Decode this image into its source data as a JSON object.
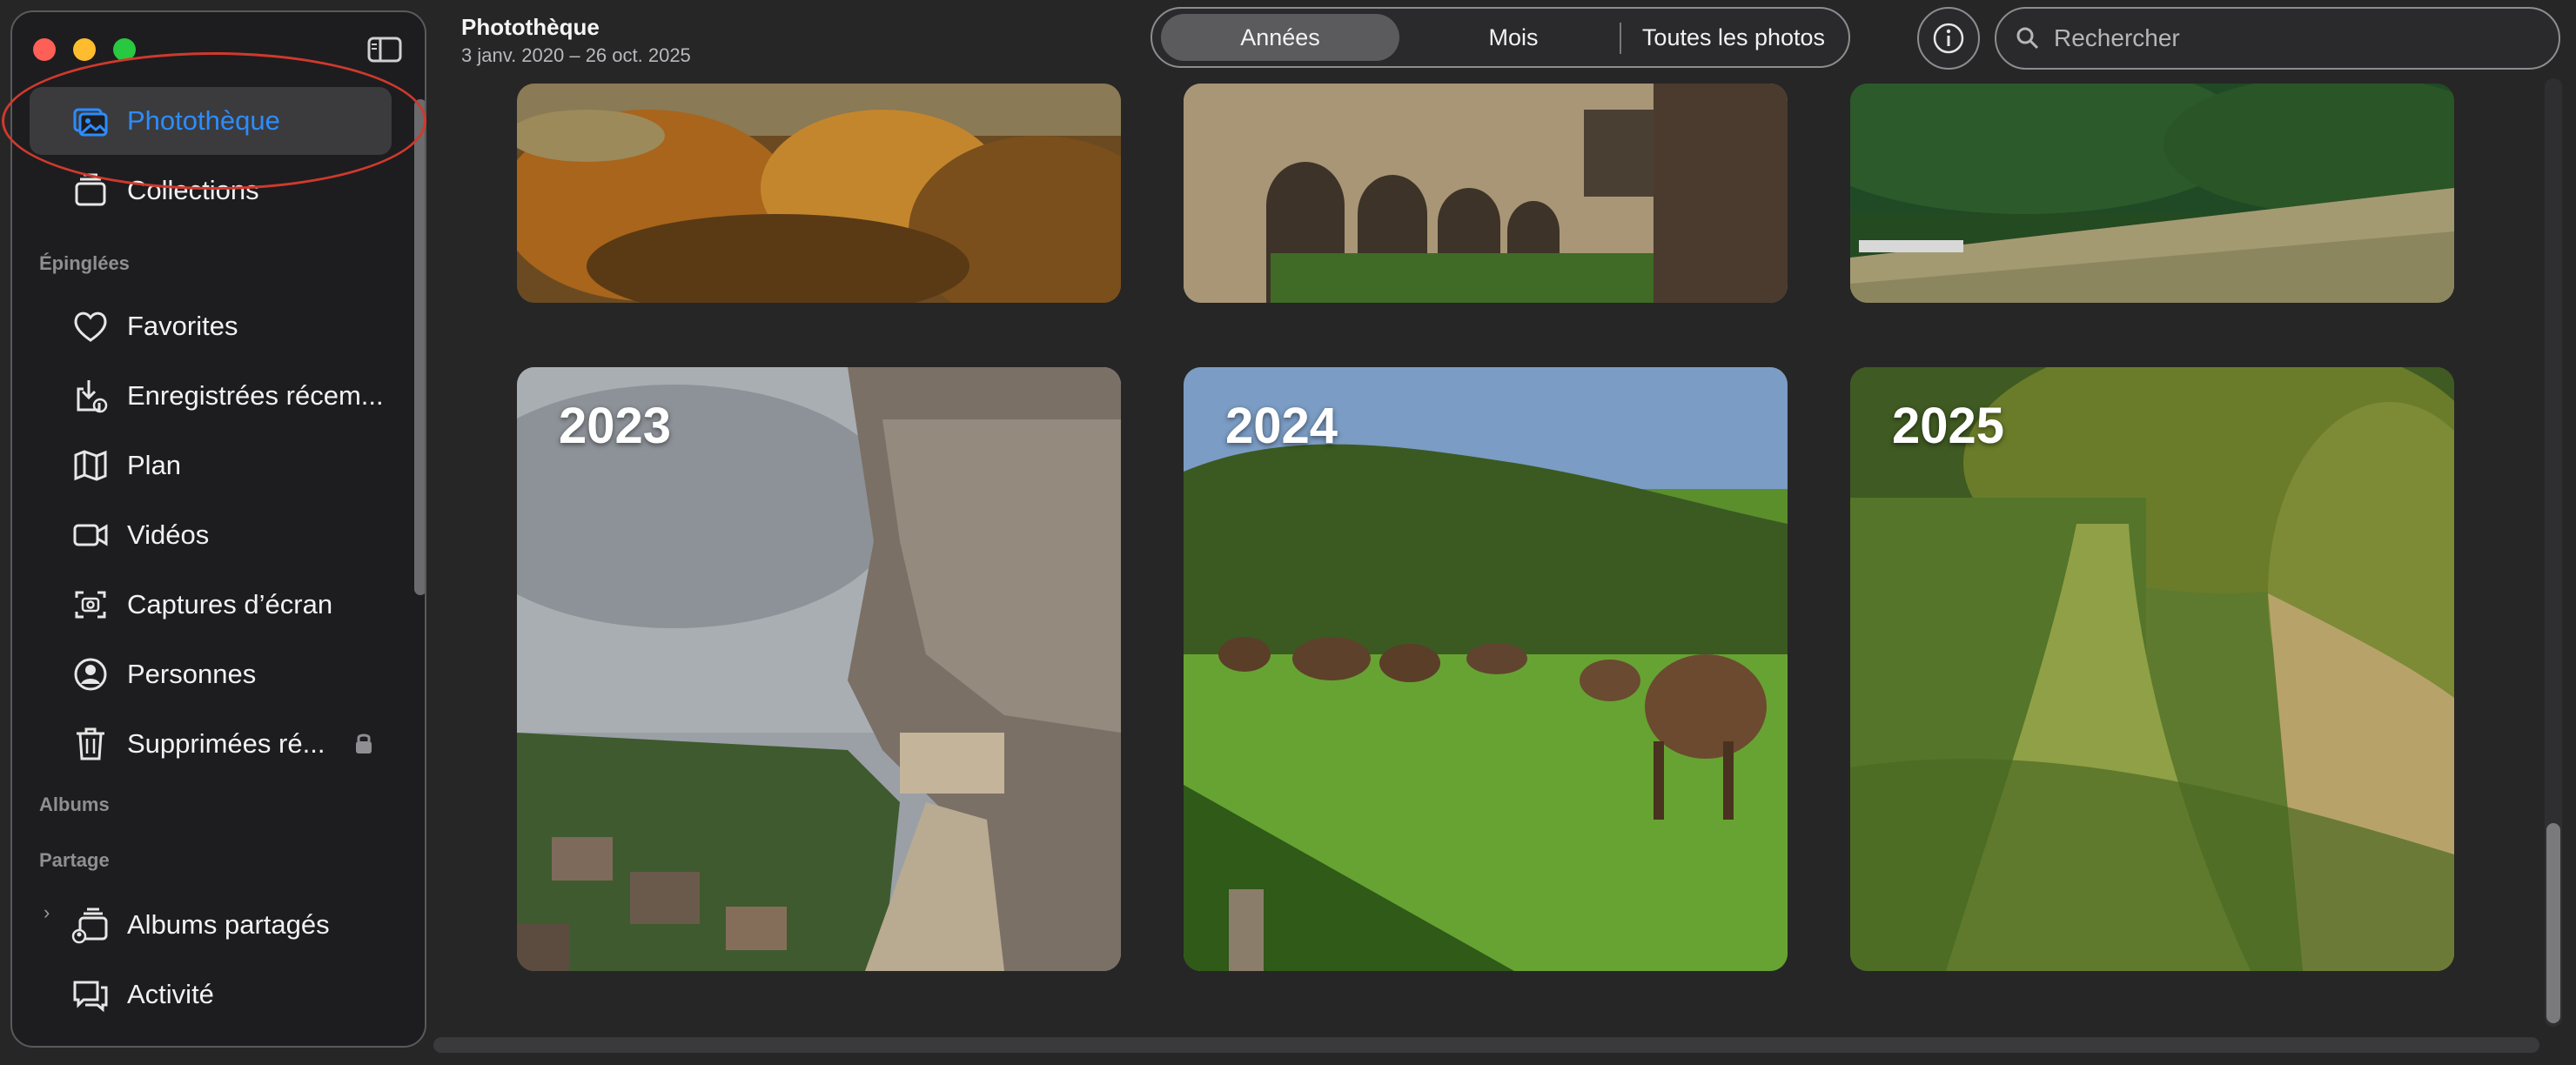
{
  "header": {
    "title": "Photothèque",
    "date_range": "3 janv. 2020 – 26 oct. 2025"
  },
  "view_tabs": [
    {
      "label": "Années",
      "active": true
    },
    {
      "label": "Mois",
      "active": false
    },
    {
      "label": "Toutes les photos",
      "active": false
    }
  ],
  "search": {
    "placeholder": "Rechercher",
    "value": ""
  },
  "sidebar": {
    "top_items": [
      {
        "label": "Photothèque",
        "icon": "photo-library-icon",
        "selected": true
      },
      {
        "label": "Collections",
        "icon": "collections-icon",
        "selected": false
      }
    ],
    "pinned_header": "Épinglées",
    "pinned_items": [
      {
        "label": "Favorites",
        "icon": "heart-icon"
      },
      {
        "label": "Enregistrées récem...",
        "icon": "recently-saved-icon"
      },
      {
        "label": "Plan",
        "icon": "map-icon"
      },
      {
        "label": "Vidéos",
        "icon": "video-icon"
      },
      {
        "label": "Captures d’écran",
        "icon": "screenshot-icon"
      },
      {
        "label": "Personnes",
        "icon": "person-icon"
      },
      {
        "label": "Supprimées ré...",
        "icon": "trash-icon",
        "locked": true
      }
    ],
    "albums_header": "Albums",
    "sharing_header": "Partage",
    "sharing_items": [
      {
        "label": "Albums partagés",
        "icon": "shared-albums-icon"
      },
      {
        "label": "Activité",
        "icon": "activity-icon"
      }
    ]
  },
  "years": [
    {
      "label": "2023"
    },
    {
      "label": "2024"
    },
    {
      "label": "2025"
    }
  ],
  "colors": {
    "accent": "#2d8cff",
    "annotation": "#d0392d",
    "window_bg": "#262626",
    "sidebar_bg": "#1d1d1f"
  }
}
